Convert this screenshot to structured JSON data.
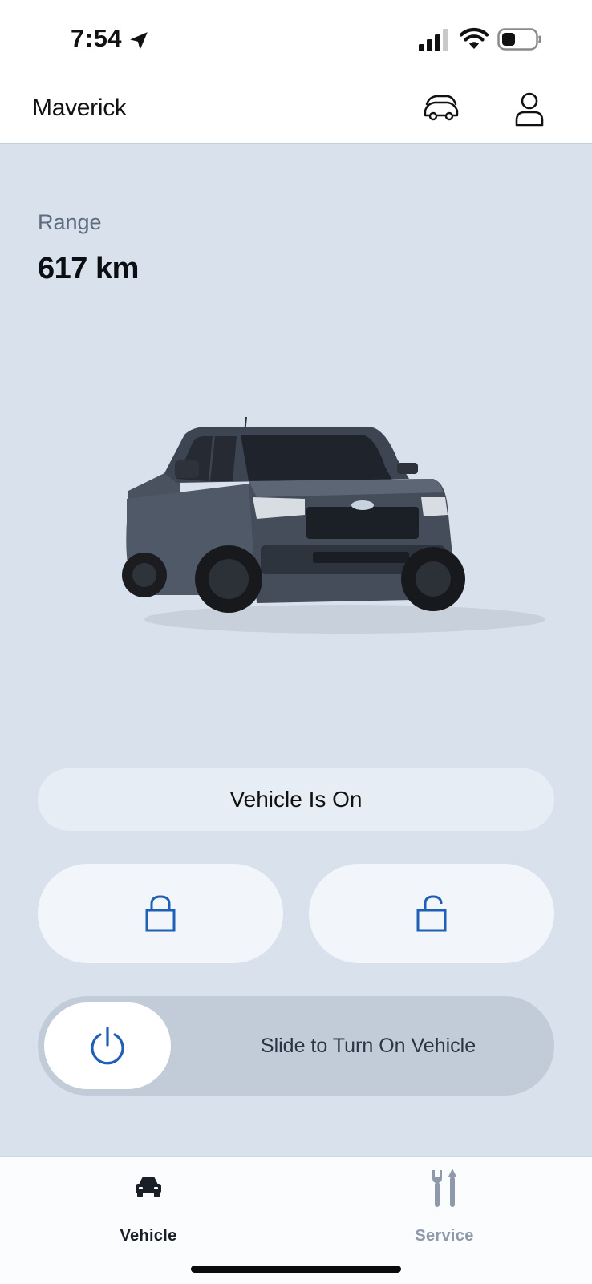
{
  "status_bar": {
    "time": "7:54",
    "icons": [
      "location-arrow-icon",
      "cellular-signal-icon",
      "wifi-icon",
      "battery-icon"
    ]
  },
  "header": {
    "title": "Maverick",
    "icons": [
      "vehicles-icon",
      "profile-icon"
    ]
  },
  "main": {
    "range_label": "Range",
    "range_value": "617 km",
    "vehicle_status": "Vehicle Is On",
    "lock_icon": "lock-icon",
    "unlock_icon": "unlock-icon",
    "slider_label": "Slide to Turn On Vehicle",
    "slider_icon": "power-icon"
  },
  "bottom_nav": {
    "tabs": [
      {
        "label": "Vehicle",
        "icon": "car-icon",
        "active": true
      },
      {
        "label": "Service",
        "icon": "tools-icon",
        "active": false
      }
    ]
  },
  "colors": {
    "accent": "#1f5fb8",
    "background": "#d9e1ec",
    "inactive_tab": "#8e9aab"
  }
}
